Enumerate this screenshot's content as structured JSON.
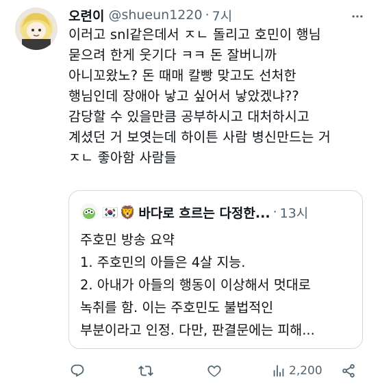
{
  "tweet": {
    "author_name": "오련이",
    "handle": "@shueun1220",
    "separator": "·",
    "time": "7시",
    "text": "이러고 snl같은데서 ㅈㄴ 돌리고 호민이 행님\n묻으려 한게 웃기다 ㅋㅋ 돈 잘버니까\n아니꼬왔노? 돈 때매 칼빵 맞고도 선처한\n행님인데 장애아 낳고 싶어서 낳았겠냐??\n감당할 수 있을만큼 공부하시고 대처하시고\n계셨던 거 보엿는데 하이튼 사람 병신만드는 거\nㅈㄴ 좋아함 사람들"
  },
  "quote": {
    "flag_emoji": "🇰🇷",
    "lion_emoji": "🦁",
    "author_name": "바다로 흐르는 다정한...",
    "separator": "·",
    "time": "13시",
    "text": "주호민 방송 요약\n1. 주호민의 아들은 4살 지능.\n2. 아내가 아들의 행동이 이상해서 멋대로\n녹취를 함. 이는 주호민도 불법적인\n부분이라고 인정. 다만, 판결문에는 피해..."
  },
  "actions": {
    "views": "2,200"
  },
  "icons": [
    "more-icon",
    "reply-icon",
    "retweet-icon",
    "like-icon",
    "views-icon",
    "share-icon"
  ],
  "colors": {
    "text": "#0f1419",
    "secondary": "#536471",
    "border": "#cfd9de"
  }
}
